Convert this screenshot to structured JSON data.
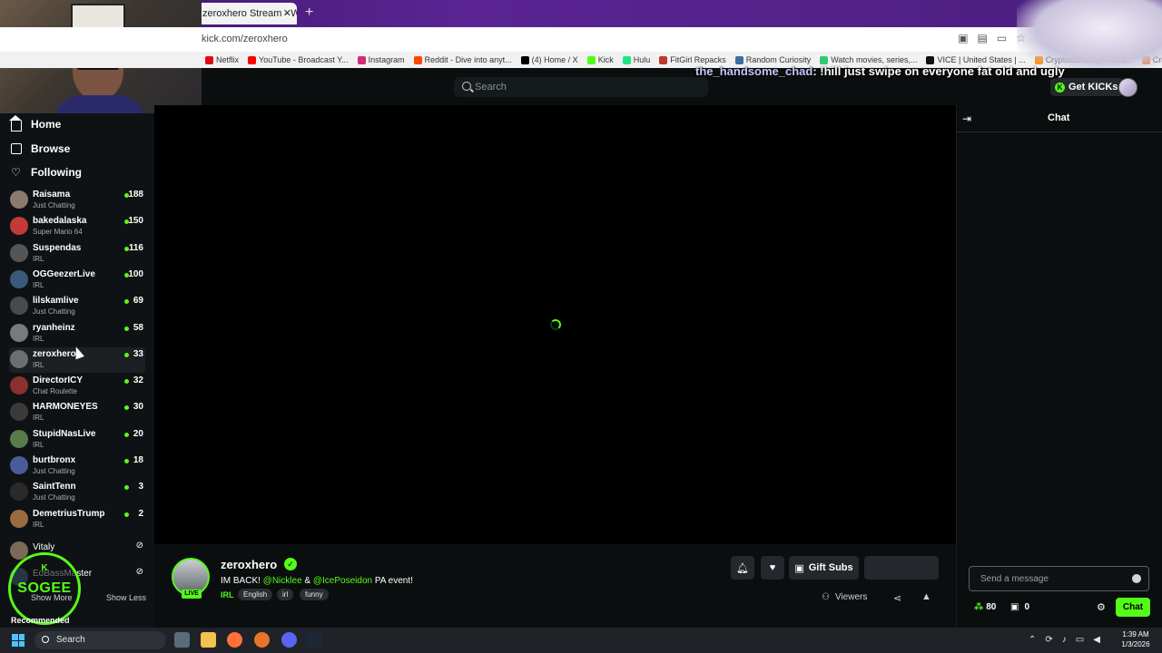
{
  "browser": {
    "tab_title": "zeroxhero Stream - Watch",
    "tab_close": "✕",
    "new_tab": "+",
    "url": "kick.com/zeroxhero",
    "bookmarks": [
      {
        "label": "Netflix",
        "color": "#e50914"
      },
      {
        "label": "YouTube - Broadcast Y...",
        "color": "#ff0000"
      },
      {
        "label": "Instagram",
        "color": "#d62976"
      },
      {
        "label": "Reddit - Dive into anyt...",
        "color": "#ff4500"
      },
      {
        "label": "(4) Home / X",
        "color": "#000000"
      },
      {
        "label": "Kick",
        "color": "#53fc18"
      },
      {
        "label": "Hulu",
        "color": "#1ce783"
      },
      {
        "label": "FitGirl Repacks",
        "color": "#c0392b"
      },
      {
        "label": "Random Curiosity",
        "color": "#3a6ea5"
      },
      {
        "label": "Watch movies, series,...",
        "color": "#2ecc71"
      },
      {
        "label": "VICE | United States | ...",
        "color": "#111111"
      },
      {
        "label": "Cryptocurrency Prices...",
        "color": "#f7931a"
      },
      {
        "label": "Crunchyr... Watch P...",
        "color": "#f47521"
      }
    ]
  },
  "header": {
    "search_placeholder": "Search",
    "chat_overlay_user": "the_handsome_chad",
    "chat_overlay_text": ": !hill just swipe on everyone fat old and ugly",
    "get_kicks": "Get KICKs",
    "kick_coin": "K"
  },
  "nav": {
    "home": "Home",
    "browse": "Browse",
    "following": "Following"
  },
  "channels": [
    {
      "name": "Raisama",
      "category": "Just Chatting",
      "viewers": "188",
      "avatar": "#8a7a70"
    },
    {
      "name": "bakedalaska",
      "category": "Super Mario 64",
      "viewers": "150",
      "avatar": "#c23a3a"
    },
    {
      "name": "Suspendas",
      "category": "IRL",
      "viewers": "116",
      "avatar": "#555555"
    },
    {
      "name": "OGGeezerLive",
      "category": "IRL",
      "viewers": "100",
      "avatar": "#3b5a7a"
    },
    {
      "name": "lilskamlive",
      "category": "Just Chatting",
      "viewers": "69",
      "avatar": "#4a4a4a"
    },
    {
      "name": "ryanheinz",
      "category": "IRL",
      "viewers": "58",
      "avatar": "#7a7a7a"
    },
    {
      "name": "zeroxhero",
      "category": "IRL",
      "viewers": "33",
      "avatar": "#6a6f74"
    },
    {
      "name": "DirectorICY",
      "category": "Chat Roulette",
      "viewers": "32",
      "avatar": "#8a3030"
    },
    {
      "name": "HARMONEYES",
      "category": "IRL",
      "viewers": "30",
      "avatar": "#3a3a3a"
    },
    {
      "name": "StupidNasLive",
      "category": "IRL",
      "viewers": "20",
      "avatar": "#5a7a4a"
    },
    {
      "name": "burtbronx",
      "category": "Just Chatting",
      "viewers": "18",
      "avatar": "#4a5a9a"
    },
    {
      "name": "SaintTenn",
      "category": "Just Chatting",
      "viewers": "3",
      "avatar": "#2a2a2a"
    },
    {
      "name": "DemetriusTrump",
      "category": "IRL",
      "viewers": "2",
      "avatar": "#9a6a40"
    }
  ],
  "offline_channels": [
    {
      "name": "Vitaly",
      "status": "offline",
      "avatar": "#7a6a5a"
    },
    {
      "name": "EdBassMaster",
      "status": "offline",
      "avatar": "#4a6a8a"
    }
  ],
  "sidebar_footer": {
    "show_more": "Show More",
    "show_less": "Show Less",
    "recommended": "Recommended",
    "logo_text": "SOGEE",
    "logo_k": "K"
  },
  "stream": {
    "name": "zeroxhero",
    "live": "LIVE",
    "verified": "✓",
    "title_prefix": "IM BACK! ",
    "mention_1": "@Nicklee",
    "amp": " & ",
    "mention_2": "@IcePoseidon",
    "title_suffix": " PA event!",
    "category": "IRL",
    "tags": [
      "English",
      "irl",
      "funny"
    ],
    "gift_subs": "Gift Subs",
    "viewers_label": "Viewers"
  },
  "chat": {
    "title": "Chat",
    "input_placeholder": "Send a message",
    "points": "80",
    "gifts": "0",
    "send": "Chat"
  },
  "taskbar": {
    "search": "Search",
    "time": "1:39 AM",
    "date": "1/3/2026"
  },
  "colors": {
    "kick_green": "#53fc18",
    "background": "#0b0e0f"
  }
}
